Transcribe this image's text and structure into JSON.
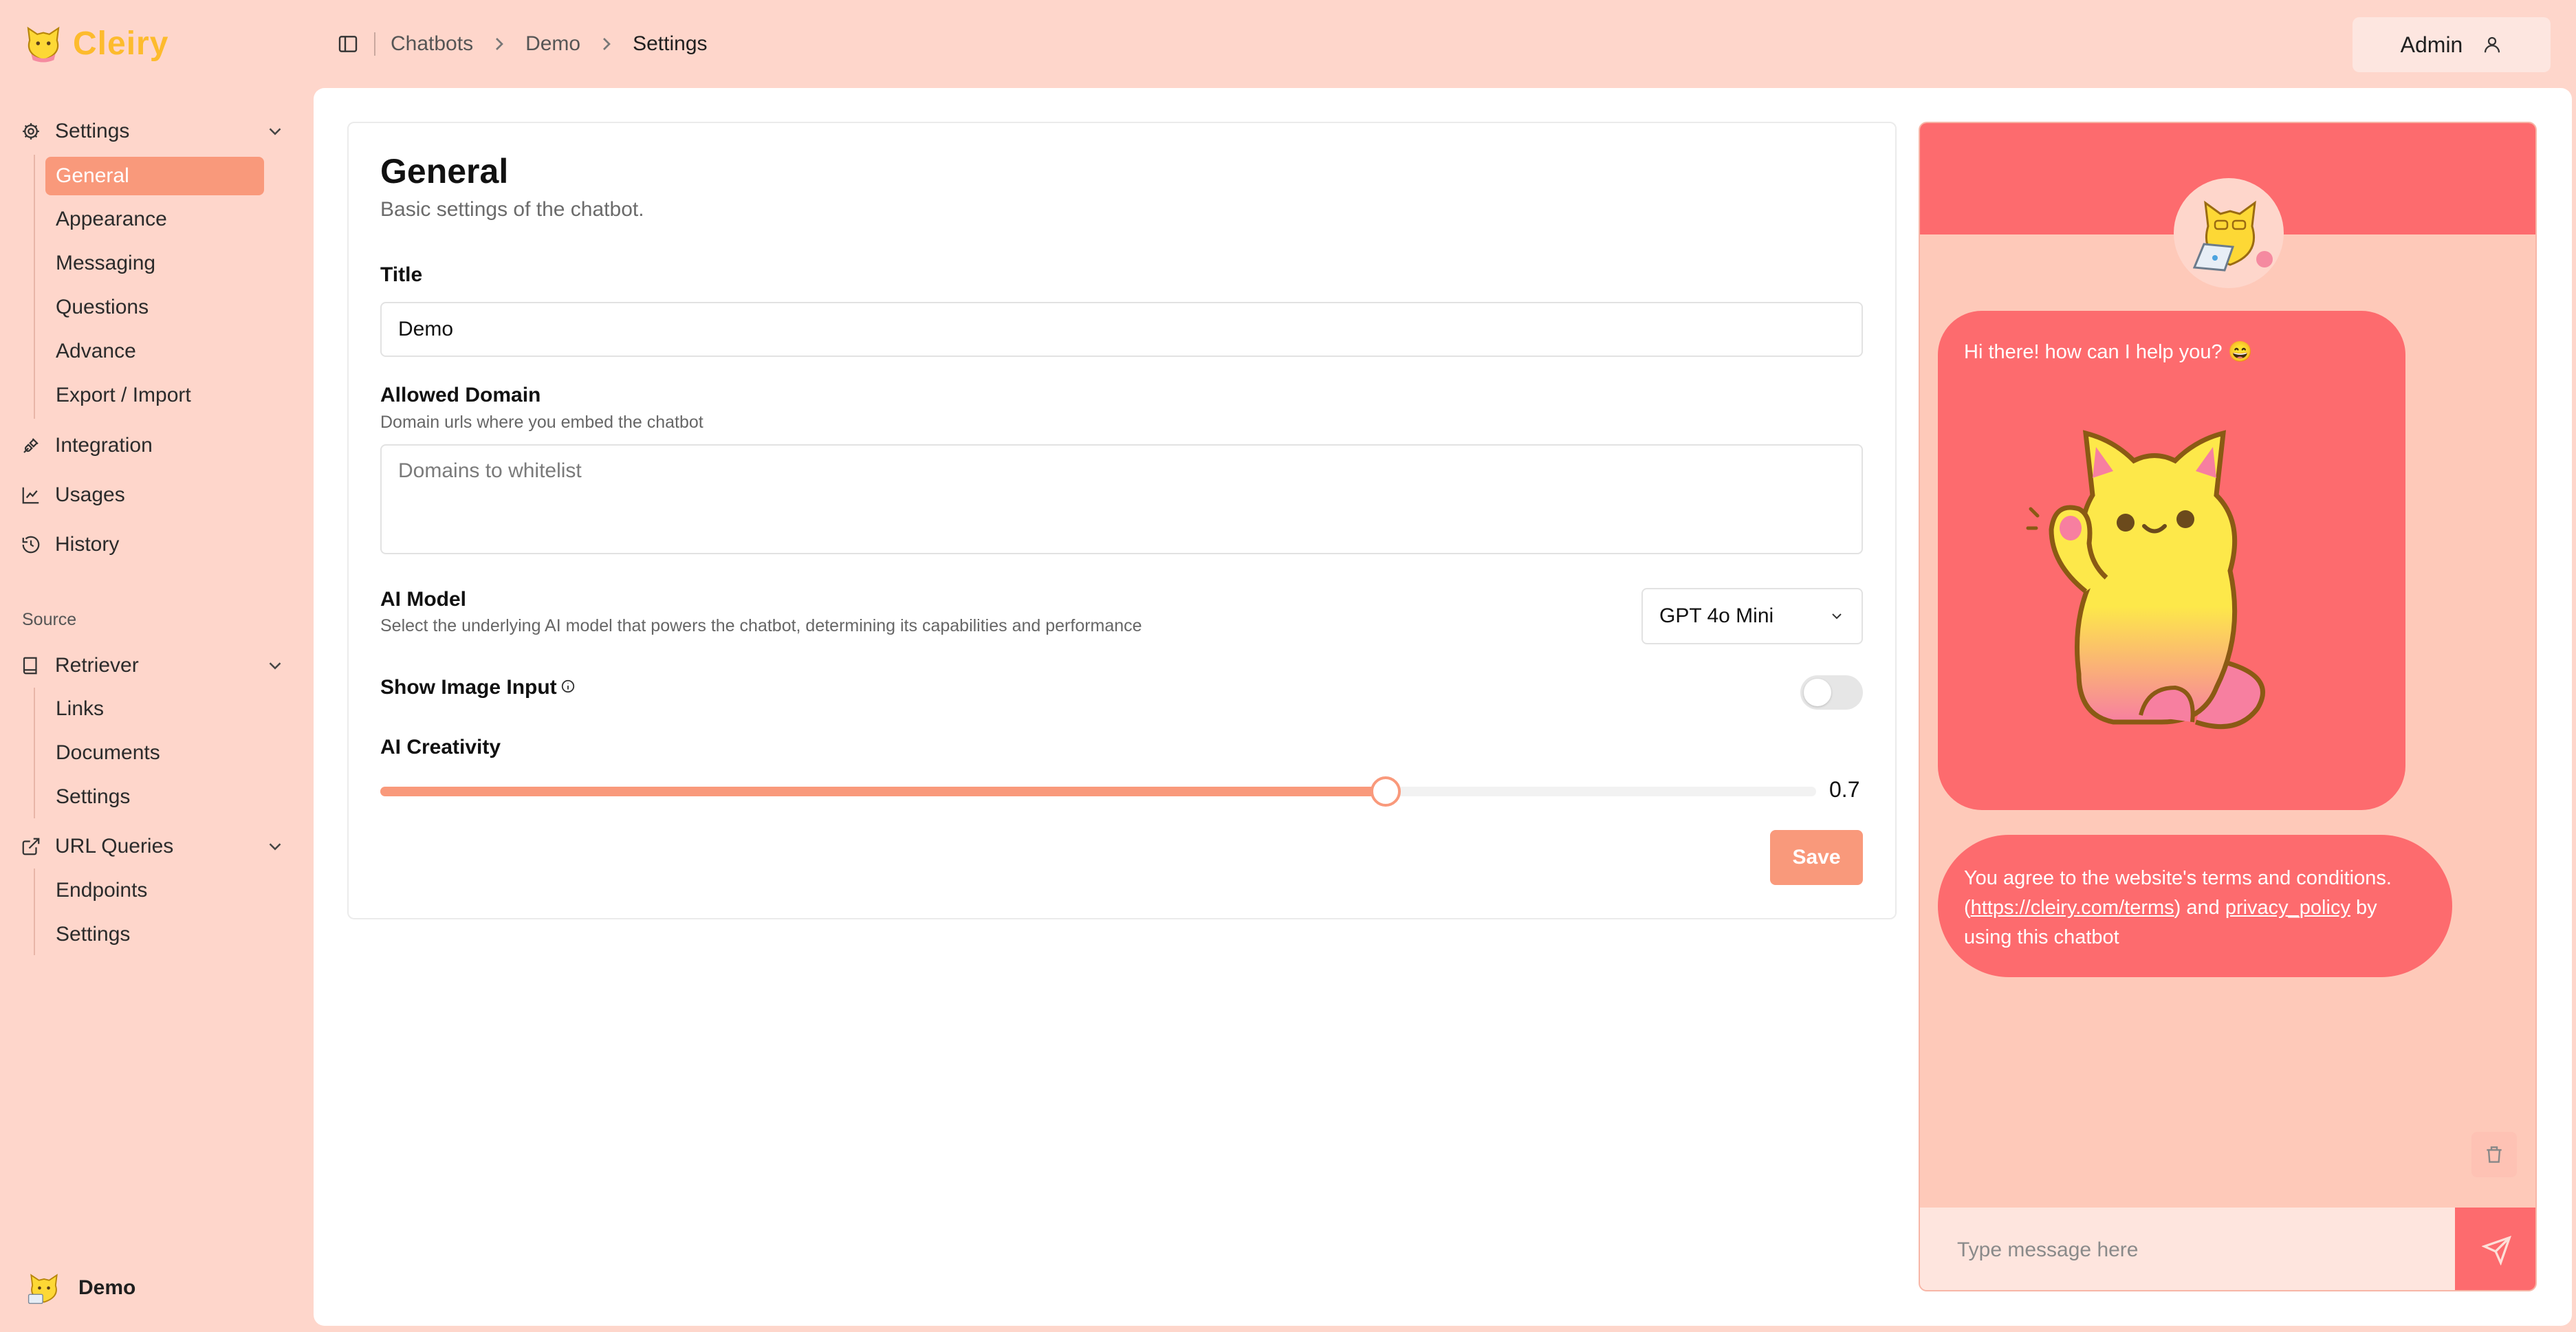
{
  "app": {
    "name": "Cleiry"
  },
  "sidebar": {
    "settings_label": "Settings",
    "settings_items": [
      "General",
      "Appearance",
      "Messaging",
      "Questions",
      "Advance",
      "Export / Import"
    ],
    "active_item": "General",
    "integration_label": "Integration",
    "usages_label": "Usages",
    "history_label": "History",
    "source_label": "Source",
    "retriever_label": "Retriever",
    "retriever_items": [
      "Links",
      "Documents",
      "Settings"
    ],
    "url_queries_label": "URL Queries",
    "url_queries_items": [
      "Endpoints",
      "Settings"
    ],
    "workspace_name": "Demo"
  },
  "breadcrumb": {
    "items": [
      "Chatbots",
      "Demo",
      "Settings"
    ]
  },
  "user": {
    "name": "Admin"
  },
  "general": {
    "title": "General",
    "subtitle": "Basic settings of the chatbot.",
    "title_label": "Title",
    "title_value": "Demo",
    "domain_label": "Allowed Domain",
    "domain_hint": "Domain urls where you embed the chatbot",
    "domain_placeholder": "Domains to whitelist",
    "model_label": "AI Model",
    "model_hint": "Select the underlying AI model that powers the chatbot, determining its capabilities and performance",
    "model_value": "GPT 4o Mini",
    "image_input_label": "Show Image Input",
    "image_input_enabled": false,
    "creativity_label": "AI Creativity",
    "creativity_value": 0.7,
    "creativity_display": "0.7",
    "save_label": "Save"
  },
  "chat": {
    "greeting": "Hi there! how can I help you? 😄",
    "terms_prefix": "You agree to the website's terms and conditions. (",
    "terms_link": "https://cleiry.com/terms",
    "terms_middle": ") and ",
    "privacy_link": "privacy_policy",
    "terms_suffix": " by using this chatbot",
    "input_placeholder": "Type message here"
  },
  "colors": {
    "background": "#fed6cb",
    "accent": "#f9997b",
    "chat_primary": "#fd6b6e",
    "logo": "#fdbb2d"
  }
}
